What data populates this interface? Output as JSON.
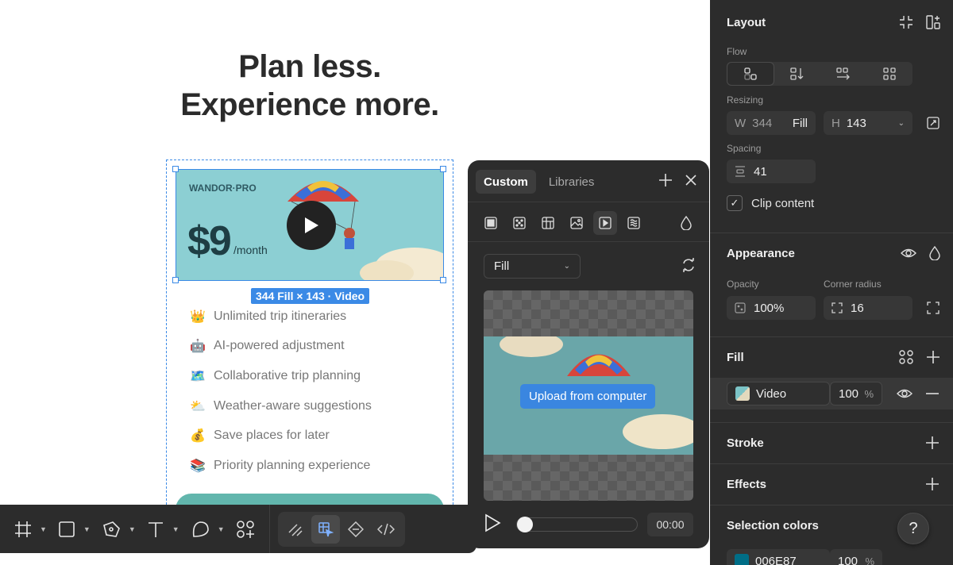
{
  "headline": {
    "line1": "Plan less.",
    "line2": "Experience more."
  },
  "banner": {
    "brand": "WANDOR·PRO",
    "price": "$9",
    "per": "/month"
  },
  "size_tag": "344 Fill × 143 · Video",
  "features": [
    {
      "emoji": "👑",
      "label": "Unlimited trip itineraries"
    },
    {
      "emoji": "🤖",
      "label": "AI-powered adjustment"
    },
    {
      "emoji": "🗺️",
      "label": "Collaborative trip planning"
    },
    {
      "emoji": "⛅",
      "label": "Weather-aware suggestions"
    },
    {
      "emoji": "💰",
      "label": "Save places for later"
    },
    {
      "emoji": "📚",
      "label": "Priority planning experience"
    }
  ],
  "toolbar": {
    "tools": [
      "frame-icon",
      "rectangle-icon",
      "pen-icon",
      "text-icon",
      "shape-icon",
      "components-icon"
    ],
    "group": [
      "draw-icon",
      "select-tool-icon",
      "dev-mode-icon",
      "code-icon"
    ]
  },
  "popover": {
    "tab_custom": "Custom",
    "tab_libraries": "Libraries",
    "fill_type": "Fill",
    "upload_label": "Upload from computer",
    "time": "00:00"
  },
  "panel": {
    "layout": {
      "title": "Layout",
      "flow_label": "Flow",
      "resizing_label": "Resizing",
      "w_prefix": "W",
      "w_value": "344",
      "w_mode": "Fill",
      "h_prefix": "H",
      "h_value": "143",
      "spacing_label": "Spacing",
      "spacing_value": "41",
      "clip_label": "Clip content"
    },
    "appearance": {
      "title": "Appearance",
      "opacity_label": "Opacity",
      "opacity_value": "100%",
      "radius_label": "Corner radius",
      "radius_value": "16"
    },
    "fill": {
      "title": "Fill",
      "type": "Video",
      "percent": "100",
      "percent_unit": "%"
    },
    "stroke": {
      "title": "Stroke"
    },
    "effects": {
      "title": "Effects"
    },
    "selection_colors": {
      "title": "Selection colors",
      "color": "006E87",
      "percent": "100",
      "percent_unit": "%"
    }
  },
  "help_label": "?",
  "colors": {
    "accent": "#3b8ae6",
    "panel": "#2c2c2c",
    "selection_color": "#006E87",
    "banner": "#8ccfd3"
  }
}
